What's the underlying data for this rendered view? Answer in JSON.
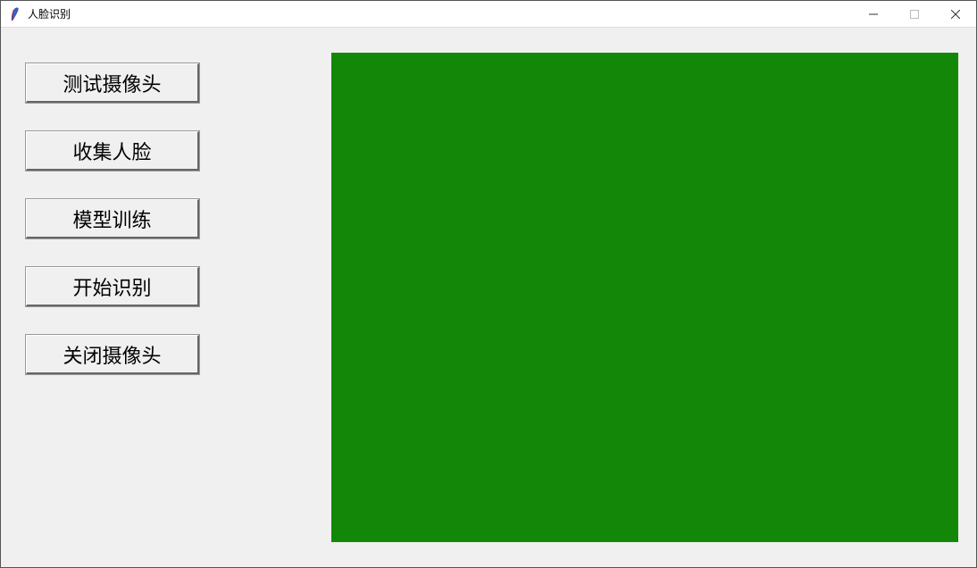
{
  "window": {
    "title": "人脸识别"
  },
  "buttons": {
    "test_camera": "测试摄像头",
    "collect_face": "收集人脸",
    "train_model": "模型训练",
    "start_recognition": "开始识别",
    "close_camera": "关闭摄像头"
  },
  "video_pane": {
    "bg_color": "#138808"
  }
}
